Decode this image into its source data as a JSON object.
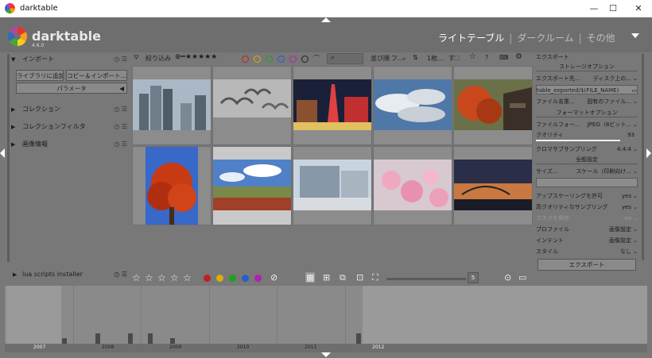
{
  "window": {
    "title": "darktable",
    "minimize": "—",
    "maximize": "☐",
    "close": "✕"
  },
  "header": {
    "brand": "darktable",
    "version": "4.6.0",
    "views": {
      "lighttable": "ライトテーブル",
      "darkroom": "ダークルーム",
      "other": "その他",
      "sep1": "|",
      "sep2": "|"
    }
  },
  "left_panel": {
    "import": {
      "label": "インポート",
      "add_to_library": "ライブラリに追加",
      "copy_import": "コピー＆インポート...",
      "parameters": "パラメータ"
    },
    "collections": "コレクション",
    "collection_filters": "コレクションフィルタ",
    "image_info": "画像情報",
    "lua_scripts": "lua scripts installer"
  },
  "toolbar": {
    "filter_label": "絞り込み",
    "sort_label": "並び順",
    "sort_value": "フ...",
    "group_label": "1枚...",
    "group_mode": "す"
  },
  "bottom_toolbar": {
    "zoom_value": "5"
  },
  "right_panel": {
    "header": "エクスポート",
    "storage_options": "ストレージオプション",
    "target_storage": {
      "label": "エクスポート先...",
      "value": "ディスク上の..."
    },
    "path": "table_exported/$(FILE_NAME)",
    "on_conflict": {
      "label": "ファイル名重...",
      "value": "固有のファイル..."
    },
    "format_options": "フォーマットオプション",
    "file_format": {
      "label": "ファイルフォー...",
      "value": "JPEG（8ビット..."
    },
    "quality": {
      "label": "クオリティ",
      "value": "93"
    },
    "chroma_subsampling": {
      "label": "クロマサブサンプリング",
      "value": "4:4:4"
    },
    "global_options": "全般設定",
    "size": {
      "label": "サイズ...",
      "value": "スケール（印刷向け..."
    },
    "allow_upscaling": {
      "label": "アップスケーリングを許可",
      "value": "yes"
    },
    "high_quality": {
      "label": "高クオリティなサンプリング",
      "value": "yes"
    },
    "store_masks": {
      "label": "マスクを保存",
      "value": "no"
    },
    "profile": {
      "label": "プロファイル",
      "value": "画像設定"
    },
    "intent": {
      "label": "インテント",
      "value": "画像設定"
    },
    "style": {
      "label": "スタイル",
      "value": "なし"
    },
    "export_button": "エクスポート"
  },
  "timeline": {
    "years": [
      "2007",
      "2008",
      "2009",
      "2010",
      "2011",
      "2012"
    ]
  },
  "colors": {
    "background": "#787878",
    "panel": "#6e6e6e",
    "selected_thumb": "#c9c9c9"
  },
  "icons": {
    "filter": "funnel-icon",
    "search": "search-icon",
    "star": "star-icon",
    "help": "help-icon",
    "keyboard": "keyboard-icon",
    "settings": "gear-icon",
    "reset": "reset-icon",
    "presets": "hamburger-icon"
  }
}
